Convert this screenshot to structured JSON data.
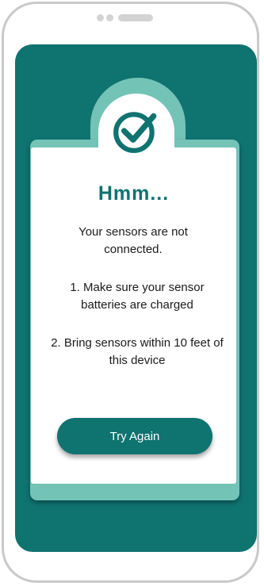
{
  "dialog": {
    "icon": "check-circle-icon",
    "title": "Hmm...",
    "message": "Your sensors are not connected.",
    "steps": [
      "1. Make sure your sensor batteries are charged",
      "2. Bring sensors within 10 feet of this device"
    ],
    "button_label": "Try Again"
  },
  "colors": {
    "primary": "#0f7370",
    "accent": "#73c3b7",
    "frame": "#c9c9c9"
  }
}
